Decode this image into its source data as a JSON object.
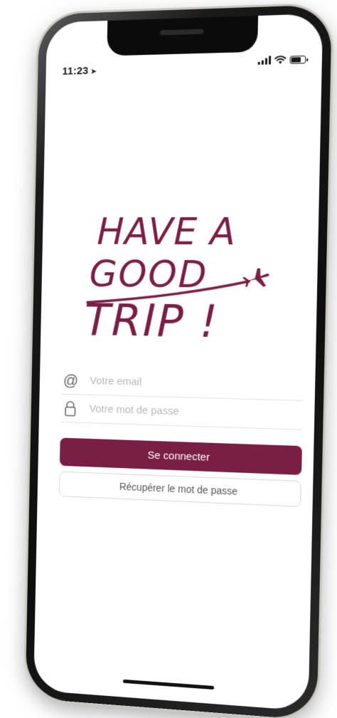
{
  "status_bar": {
    "time": "11:23",
    "location_glyph": "➤"
  },
  "logo": {
    "line1": "HAVE A",
    "line2": "GOOD",
    "line3": "TRIP !"
  },
  "login": {
    "email_icon": "@",
    "email_placeholder": "Votre email",
    "password_placeholder": "Votre mot de passe",
    "submit_label": "Se connecter",
    "recover_label": "Récupérer le mot de passe"
  },
  "colors": {
    "brand": "#7a1e45"
  }
}
